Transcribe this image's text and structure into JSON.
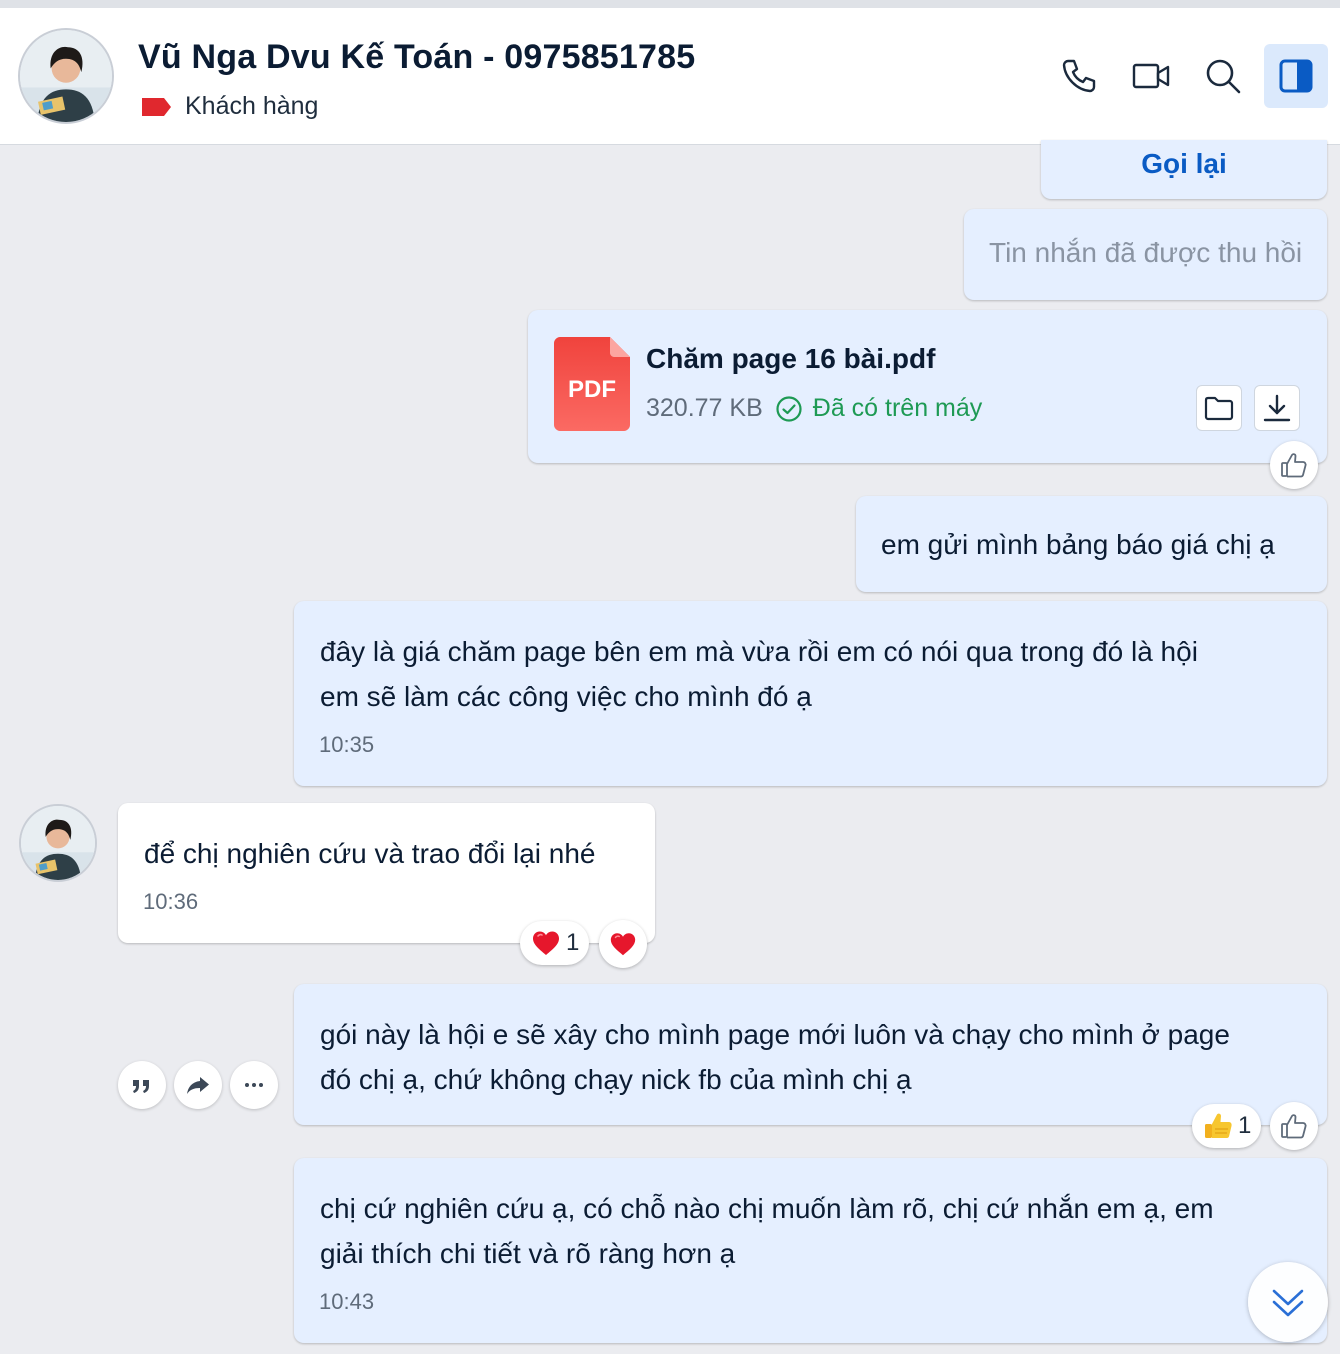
{
  "header": {
    "title": "Vũ Nga Dvu Kế Toán - 0975851785",
    "tag_label": "Khách hàng",
    "tag_color": "#e0282e"
  },
  "messages": {
    "callback_label": "Gọi lại",
    "recalled_text": "Tin nhắn đã được thu hồi",
    "file": {
      "name": "Chăm page 16 bài.pdf",
      "size": "320.77 KB",
      "status": "Đã có trên máy",
      "type_label": "PDF"
    },
    "msg1": {
      "text": "em gửi mình bảng báo giá chị ạ"
    },
    "msg2": {
      "lines": [
        "đây là giá chăm page bên em mà vừa rồi em có nói qua trong đó là hội",
        "em sẽ làm các công việc cho mình đó ạ"
      ],
      "time": "10:35"
    },
    "msg3": {
      "text": "để chị nghiên cứu và trao đổi lại nhé",
      "time": "10:36",
      "reaction_count": "1"
    },
    "msg4": {
      "lines": [
        "gói này là hội e sẽ xây cho mình page mới luôn và chạy cho mình ở page",
        "đó chị ạ, chứ không chạy nick fb của mình chị ạ"
      ],
      "reaction_count": "1"
    },
    "msg5": {
      "lines": [
        "chị cứ nghiên cứu ạ, có chỗ nào chị muốn làm rõ, chị cứ nhắn em ạ, em",
        "giải thích chi tiết và rõ ràng hơn ạ"
      ],
      "time": "10:43"
    }
  },
  "colors": {
    "accent": "#0a5bc4",
    "outgoing_bubble": "#e5efff",
    "incoming_bubble": "#ffffff",
    "background": "#ebecf0",
    "success": "#1e9a54"
  },
  "icons": [
    "phone-icon",
    "video-icon",
    "search-icon",
    "sidebar-toggle-icon",
    "pdf-file-icon",
    "folder-icon",
    "download-icon",
    "like-icon",
    "heart-icon",
    "thumbs-up-emoji-icon",
    "quote-icon",
    "share-icon",
    "more-icon",
    "chevron-double-down-icon"
  ]
}
